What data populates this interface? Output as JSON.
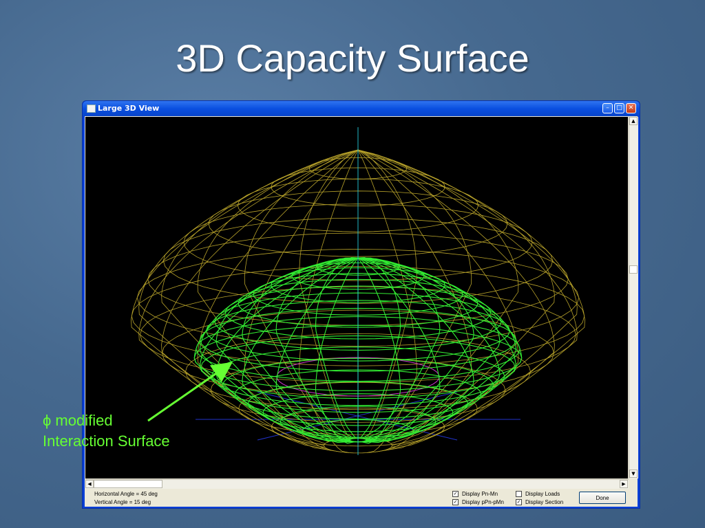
{
  "slide": {
    "title": "3D Capacity Surface"
  },
  "window": {
    "title": "Large 3D View",
    "min_glyph": "–",
    "max_glyph": "□",
    "close_glyph": "✕"
  },
  "status": {
    "horizontal_angle": "Horizontal Angle = 45 deg",
    "vertical_angle": "Vertical Angle = 15 deg"
  },
  "options": {
    "pn_mn": {
      "label": "Display Pn-Mn",
      "checked": true,
      "mark": "✓"
    },
    "ppn_pmn": {
      "label": "Display pPn-pMn",
      "checked": true,
      "mark": "✓"
    },
    "loads": {
      "label": "Display Loads",
      "checked": false,
      "mark": ""
    },
    "section": {
      "label": "Display Section",
      "checked": true,
      "mark": "✓"
    }
  },
  "buttons": {
    "done": "Done"
  },
  "annotation": {
    "line1": "ϕ modified",
    "line2": "Interaction Surface"
  },
  "colors": {
    "nominal_surface": "#b7a22a",
    "modified_surface": "#33ee33",
    "axis": "#1fb7c8",
    "section": "#cc33cc",
    "ground_axes": "#2233cc",
    "annotation": "#66ff33"
  },
  "icons": [
    "window-app-icon",
    "minimize-icon",
    "maximize-icon",
    "close-icon",
    "scroll-up-icon",
    "scroll-down-icon",
    "scroll-left-icon",
    "scroll-right-icon"
  ]
}
